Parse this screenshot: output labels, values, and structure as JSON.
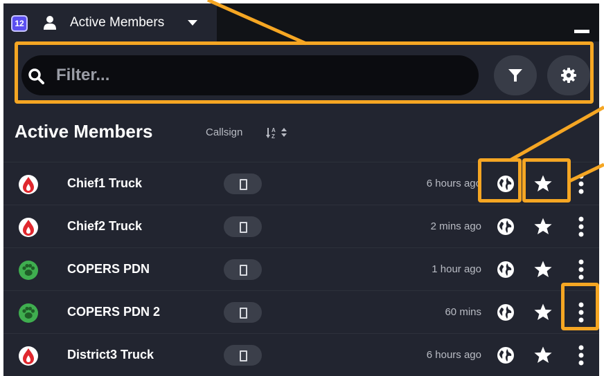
{
  "tab": {
    "badge_count": "12",
    "title": "Active Members",
    "icons": [
      "user-icon",
      "caret-down-icon",
      "minimize-icon"
    ]
  },
  "search": {
    "placeholder": "Filter...",
    "value": "",
    "icons": [
      "search-icon",
      "filter-icon",
      "gear-icon"
    ]
  },
  "list": {
    "title": "Active Members",
    "sort_label": "Callsign",
    "sort_icon": "sort-alpha-icon",
    "members": [
      {
        "name": "Chief1 Truck",
        "time": "6 hours ago",
        "avatar": "fire-drop-icon",
        "avatar_color": "#ffffff",
        "glyph_color": "#e0282e"
      },
      {
        "name": "Chief2 Truck",
        "time": "2 mins ago",
        "avatar": "fire-drop-icon",
        "avatar_color": "#ffffff",
        "glyph_color": "#e0282e"
      },
      {
        "name": "COPERS PDN",
        "time": "1 hour ago",
        "avatar": "paw-icon",
        "avatar_color": "#3fae4f",
        "glyph_color": "#1f5e27"
      },
      {
        "name": "COPERS PDN 2",
        "time": "60 mins",
        "avatar": "paw-icon",
        "avatar_color": "#3fae4f",
        "glyph_color": "#1f5e27"
      },
      {
        "name": "District3 Truck",
        "time": "6 hours ago",
        "avatar": "fire-drop-icon",
        "avatar_color": "#ffffff",
        "glyph_color": "#e0282e"
      }
    ],
    "row_icons": [
      "device-icon",
      "globe-icon",
      "star-icon",
      "more-vertical-icon"
    ]
  },
  "colors": {
    "panel_bg": "#222530",
    "tabbar_bg": "#111317",
    "badge_bg": "#5b4ff0",
    "callout": "#f5a623"
  }
}
